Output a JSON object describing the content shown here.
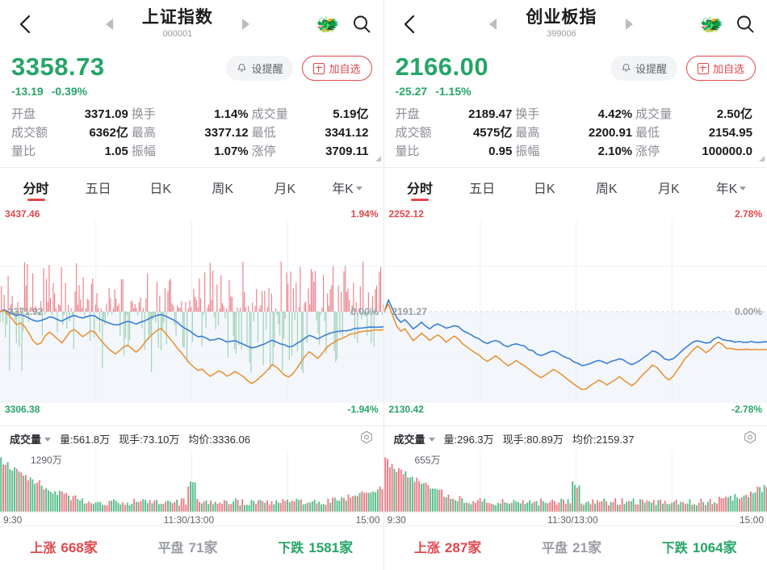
{
  "panels": [
    {
      "nav": {
        "back_icon": "chevron-left-icon",
        "prev_icon": "triangle-left-icon",
        "next_icon": "triangle-right-icon",
        "title": "上证指数",
        "code": "000001",
        "mascot_icon": "dragon-face-emoji",
        "mascot_glyph": "🐲",
        "search_icon": "search-icon"
      },
      "quote": {
        "price": "3358.73",
        "change": "-13.19",
        "change_pct": "-0.39%",
        "direction": "down",
        "alert_label": "设提醒",
        "alert_icon": "bell-icon",
        "add_label": "加自选",
        "add_icon": "plus-box-icon"
      },
      "stats": [
        {
          "key": "开盘",
          "value": "3371.09",
          "tone": "down"
        },
        {
          "key": "换手",
          "value": "1.14%",
          "tone": "neutral"
        },
        {
          "key": "成交量",
          "value": "5.19亿",
          "tone": "neutral"
        },
        {
          "key": "成交额",
          "value": "6362亿",
          "tone": "neutral"
        },
        {
          "key": "最高",
          "value": "3377.12",
          "tone": "up"
        },
        {
          "key": "最低",
          "value": "3341.12",
          "tone": "down"
        },
        {
          "key": "量比",
          "value": "1.05",
          "tone": "neutral"
        },
        {
          "key": "振幅",
          "value": "1.07%",
          "tone": "neutral"
        },
        {
          "key": "涨停",
          "value": "3709.11",
          "tone": "up"
        }
      ],
      "tabs": [
        {
          "label": "分时",
          "active": true
        },
        {
          "label": "五日",
          "active": false
        },
        {
          "label": "日K",
          "active": false
        },
        {
          "label": "周K",
          "active": false
        },
        {
          "label": "月K",
          "active": false
        },
        {
          "label": "年K",
          "active": false,
          "caret": true
        }
      ],
      "chart_labels": {
        "top_price": "3437.46",
        "top_pct": "1.94%",
        "mid_price": "3371.92",
        "mid_pct": "0.00%",
        "bottom_price": "3306.38",
        "bottom_pct": "-1.94%"
      },
      "volume": {
        "name": "成交量",
        "caret_icon": "chevron-down-icon",
        "total": "量:561.8万",
        "current": "现手:73.10万",
        "avg": "均价:3336.06",
        "gear_icon": "settings-hex-icon",
        "max_label": "1290万",
        "axis": [
          "9:30",
          "11:30/13:00",
          "15:00"
        ]
      },
      "breadth": [
        {
          "label": "上涨",
          "value": "668家",
          "tone": "up"
        },
        {
          "label": "平盘",
          "value": "71家",
          "tone": "flat"
        },
        {
          "label": "下跌",
          "value": "1581家",
          "tone": "down"
        }
      ]
    },
    {
      "nav": {
        "back_icon": "chevron-left-icon",
        "prev_icon": "triangle-left-icon",
        "next_icon": "triangle-right-icon",
        "title": "创业板指",
        "code": "399006",
        "mascot_icon": "dragon-face-emoji",
        "mascot_glyph": "🐲",
        "search_icon": "search-icon"
      },
      "quote": {
        "price": "2166.00",
        "change": "-25.27",
        "change_pct": "-1.15%",
        "direction": "down",
        "alert_label": "设提醒",
        "alert_icon": "bell-icon",
        "add_label": "加自选",
        "add_icon": "plus-box-icon"
      },
      "stats": [
        {
          "key": "开盘",
          "value": "2189.47",
          "tone": "down"
        },
        {
          "key": "换手",
          "value": "4.42%",
          "tone": "neutral"
        },
        {
          "key": "成交量",
          "value": "2.50亿",
          "tone": "neutral"
        },
        {
          "key": "成交额",
          "value": "4575亿",
          "tone": "neutral"
        },
        {
          "key": "最高",
          "value": "2200.91",
          "tone": "up"
        },
        {
          "key": "最低",
          "value": "2154.95",
          "tone": "down"
        },
        {
          "key": "量比",
          "value": "0.95",
          "tone": "neutral"
        },
        {
          "key": "振幅",
          "value": "2.10%",
          "tone": "neutral"
        },
        {
          "key": "涨停",
          "value": "100000.0",
          "tone": "up"
        }
      ],
      "tabs": [
        {
          "label": "分时",
          "active": true
        },
        {
          "label": "五日",
          "active": false
        },
        {
          "label": "日K",
          "active": false
        },
        {
          "label": "周K",
          "active": false
        },
        {
          "label": "月K",
          "active": false
        },
        {
          "label": "年K",
          "active": false,
          "caret": true
        }
      ],
      "chart_labels": {
        "top_price": "2252.12",
        "top_pct": "2.78%",
        "mid_price": "2191.27",
        "mid_pct": "0.00%",
        "bottom_price": "2130.42",
        "bottom_pct": "-2.78%"
      },
      "volume": {
        "name": "成交量",
        "caret_icon": "chevron-down-icon",
        "total": "量:296.3万",
        "current": "现手:80.89万",
        "avg": "均价:2159.37",
        "gear_icon": "settings-hex-icon",
        "max_label": "655万",
        "axis": [
          "9:30",
          "11:30/13:00",
          "15:00"
        ]
      },
      "breadth": [
        {
          "label": "上涨",
          "value": "287家",
          "tone": "up"
        },
        {
          "label": "平盘",
          "value": "21家",
          "tone": "flat"
        },
        {
          "label": "下跌",
          "value": "1064家",
          "tone": "down"
        }
      ]
    }
  ],
  "colors": {
    "up": "#e0474c",
    "down": "#26a567",
    "flat": "#9a9da2",
    "price_line": "#e8943a",
    "avg_line": "#3a7fd5",
    "bar_up": "#e8707a",
    "bar_down": "#8dc9a8",
    "accent": "#e0474c"
  },
  "chart_data": [
    {
      "type": "line",
      "title": "上证指数 分时",
      "xlabel": "",
      "ylabel": "",
      "ylim": [
        3306.38,
        3437.46
      ],
      "y2lim": [
        -1.94,
        1.94
      ],
      "mid": 3371.92,
      "x": [
        "9:30",
        "11:30/13:00",
        "15:00"
      ],
      "grid": true,
      "legend": [
        "指数",
        "均价"
      ],
      "series": [
        {
          "name": "指数",
          "color": "#e8943a",
          "values": [
            3371.9,
            3372.5,
            3370.0,
            3366.2,
            3362.5,
            3364.0,
            3361.0,
            3356.5,
            3351.0,
            3348.5,
            3350.0,
            3354.5,
            3357.0,
            3355.0,
            3352.5,
            3349.0,
            3353.5,
            3357.5,
            3359.5,
            3356.5,
            3354.0,
            3356.0,
            3358.5,
            3357.0,
            3353.0,
            3349.5,
            3346.0,
            3343.5,
            3341.5,
            3344.0,
            3346.5,
            3348.0,
            3345.5,
            3343.0,
            3345.5,
            3349.5,
            3353.0,
            3356.0,
            3358.5,
            3359.5,
            3357.0,
            3353.5,
            3350.0,
            3346.0,
            3342.0,
            3338.5,
            3335.0,
            3332.0,
            3329.5,
            3330.5,
            3328.0,
            3325.5,
            3327.5,
            3329.5,
            3328.0,
            3325.5,
            3327.0,
            3329.0,
            3327.5,
            3325.0,
            3322.5,
            3320.5,
            3322.0,
            3324.5,
            3327.0,
            3330.5,
            3334.0,
            3332.0,
            3329.0,
            3326.5,
            3325.0,
            3327.0,
            3331.0,
            3336.0,
            3340.0,
            3343.0,
            3341.0,
            3338.5,
            3341.5,
            3345.0,
            3348.0,
            3350.0,
            3351.5,
            3353.0,
            3354.5,
            3355.5,
            3356.5,
            3357.5,
            3358.0,
            3358.3,
            3358.5,
            3358.6,
            3358.7,
            3358.73
          ]
        },
        {
          "name": "均价",
          "color": "#3a7fd5",
          "values": [
            3371.9,
            3373.5,
            3372.0,
            3370.5,
            3369.0,
            3369.5,
            3368.5,
            3367.0,
            3365.5,
            3365.0,
            3365.5,
            3367.0,
            3368.0,
            3367.5,
            3366.5,
            3365.5,
            3367.0,
            3368.5,
            3369.5,
            3368.5,
            3367.5,
            3368.0,
            3369.0,
            3368.5,
            3367.0,
            3365.5,
            3364.0,
            3363.0,
            3362.0,
            3363.0,
            3364.0,
            3365.0,
            3364.0,
            3363.0,
            3364.0,
            3365.5,
            3367.0,
            3368.5,
            3369.5,
            3370.0,
            3369.0,
            3367.5,
            3366.0,
            3364.0,
            3362.0,
            3360.0,
            3358.0,
            3356.0,
            3354.0,
            3354.0,
            3352.5,
            3351.0,
            3351.5,
            3352.5,
            3351.5,
            3350.0,
            3350.5,
            3351.0,
            3350.0,
            3348.5,
            3347.0,
            3346.0,
            3346.5,
            3347.5,
            3348.5,
            3350.0,
            3351.5,
            3350.5,
            3349.0,
            3348.0,
            3347.0,
            3347.5,
            3349.0,
            3351.0,
            3353.0,
            3354.5,
            3353.5,
            3352.5,
            3353.5,
            3355.0,
            3356.0,
            3357.0,
            3357.5,
            3358.0,
            3358.5,
            3359.0,
            3359.5,
            3360.0,
            3360.3,
            3360.5,
            3360.7,
            3360.8,
            3360.9,
            3361.0
          ]
        }
      ]
    },
    {
      "type": "bar",
      "title": "上证指数 成交量",
      "xlabel": "",
      "ylabel": "成交量(万)",
      "ylim": [
        0,
        1290
      ],
      "max_label": "1290万",
      "categories": [
        "9:30",
        "11:30/13:00",
        "15:00"
      ]
    },
    {
      "type": "line",
      "title": "创业板指 分时",
      "xlabel": "",
      "ylabel": "",
      "ylim": [
        2130.42,
        2252.12
      ],
      "y2lim": [
        -2.78,
        2.78
      ],
      "mid": 2191.27,
      "x": [
        "9:30",
        "11:30/13:00",
        "15:00"
      ],
      "grid": true,
      "legend": [
        "指数",
        "均价"
      ],
      "series": [
        {
          "name": "指数",
          "color": "#e8943a",
          "values": [
            2191.3,
            2196.0,
            2189.0,
            2182.0,
            2178.0,
            2180.0,
            2176.0,
            2172.0,
            2174.0,
            2177.0,
            2175.0,
            2172.0,
            2174.0,
            2176.0,
            2174.0,
            2171.0,
            2173.0,
            2175.0,
            2173.0,
            2170.0,
            2168.0,
            2166.0,
            2164.0,
            2162.0,
            2160.0,
            2158.0,
            2160.0,
            2162.0,
            2160.0,
            2157.0,
            2155.0,
            2157.0,
            2159.0,
            2157.0,
            2155.0,
            2153.0,
            2151.0,
            2149.0,
            2147.0,
            2149.0,
            2151.0,
            2153.0,
            2151.0,
            2149.0,
            2147.0,
            2145.0,
            2143.0,
            2141.0,
            2139.0,
            2140.0,
            2142.0,
            2144.0,
            2146.0,
            2144.0,
            2142.0,
            2144.0,
            2146.0,
            2148.0,
            2146.0,
            2144.0,
            2142.0,
            2144.0,
            2147.0,
            2150.0,
            2153.0,
            2156.0,
            2154.0,
            2151.0,
            2148.0,
            2146.0,
            2148.0,
            2152.0,
            2156.0,
            2160.0,
            2163.0,
            2166.0,
            2168.0,
            2166.0,
            2164.0,
            2166.0,
            2169.0,
            2171.0,
            2169.0,
            2167.0,
            2166.5,
            2166.0,
            2166.2,
            2166.0,
            2166.0,
            2166.0,
            2166.0,
            2166.0,
            2166.0,
            2166.0
          ]
        },
        {
          "name": "均价",
          "color": "#3a7fd5",
          "values": [
            2191.3,
            2199.0,
            2193.0,
            2187.0,
            2184.0,
            2186.0,
            2183.0,
            2180.0,
            2182.0,
            2184.0,
            2182.0,
            2180.0,
            2182.0,
            2183.0,
            2182.0,
            2180.0,
            2181.0,
            2182.0,
            2181.0,
            2179.0,
            2177.0,
            2176.0,
            2174.0,
            2173.0,
            2171.0,
            2170.0,
            2171.0,
            2172.0,
            2171.0,
            2169.0,
            2168.0,
            2169.0,
            2170.0,
            2169.0,
            2168.0,
            2166.0,
            2165.0,
            2163.0,
            2162.0,
            2163.0,
            2164.0,
            2165.0,
            2164.0,
            2162.0,
            2161.0,
            2160.0,
            2158.0,
            2157.0,
            2155.0,
            2156.0,
            2157.0,
            2158.0,
            2159.0,
            2158.0,
            2157.0,
            2158.0,
            2159.0,
            2160.0,
            2159.0,
            2157.0,
            2156.0,
            2157.0,
            2159.0,
            2161.0,
            2163.0,
            2165.0,
            2164.0,
            2162.0,
            2160.0,
            2159.0,
            2160.0,
            2162.0,
            2165.0,
            2167.0,
            2169.0,
            2171.0,
            2172.0,
            2171.0,
            2170.0,
            2171.0,
            2173.0,
            2174.0,
            2173.0,
            2172.0,
            2171.5,
            2171.0,
            2171.0,
            2171.0,
            2171.0,
            2171.0,
            2171.0,
            2171.0,
            2171.0,
            2171.0
          ]
        }
      ]
    },
    {
      "type": "bar",
      "title": "创业板指 成交量",
      "xlabel": "",
      "ylabel": "成交量(万)",
      "ylim": [
        0,
        655
      ],
      "max_label": "655万",
      "categories": [
        "9:30",
        "11:30/13:00",
        "15:00"
      ]
    }
  ]
}
